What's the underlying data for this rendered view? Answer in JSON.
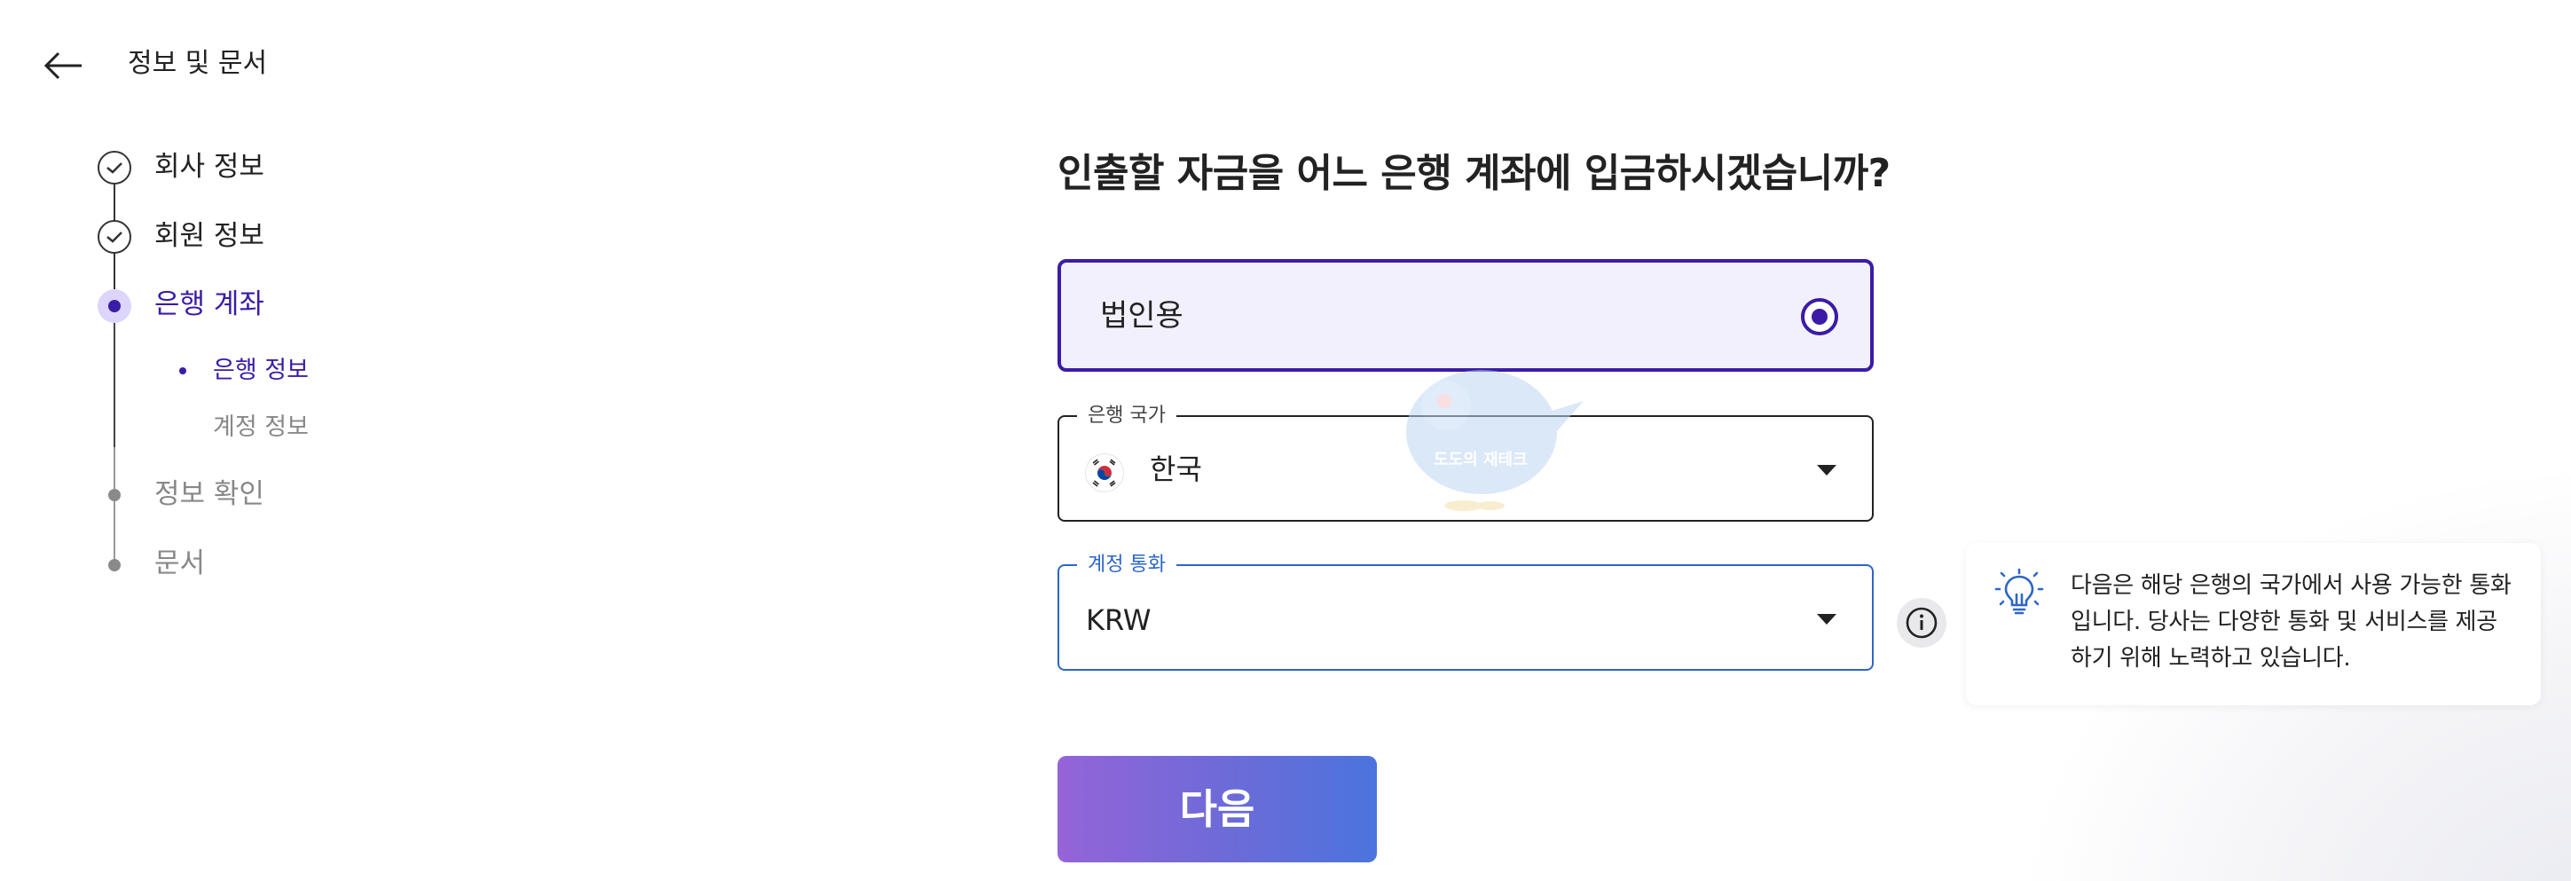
{
  "header": {
    "back_icon": "arrow-left-icon",
    "title": "정보 및 문서"
  },
  "stepper": {
    "steps": [
      {
        "label": "회사 정보",
        "status": "completed"
      },
      {
        "label": "회원 정보",
        "status": "completed"
      },
      {
        "label": "은행 계좌",
        "status": "active"
      },
      {
        "label": "정보 확인",
        "status": "pending"
      },
      {
        "label": "문서",
        "status": "pending"
      }
    ],
    "substeps": [
      {
        "label": "은행 정보",
        "status": "active"
      },
      {
        "label": "계정 정보",
        "status": "pending"
      }
    ]
  },
  "main": {
    "question": "인출할 자금을 어느 은행 계좌에 입금하시겠습니까?",
    "account_type": {
      "label": "법인용",
      "selected": true
    },
    "bank_country": {
      "legend": "은행 국가",
      "value": "한국",
      "flag": "south-korea-flag"
    },
    "currency": {
      "legend": "계정 통화",
      "value": "KRW"
    },
    "next_button": "다음"
  },
  "tooltip": {
    "icon": "lightbulb-icon",
    "text": "다음은 해당 은행의 국가에서 사용 가능한 통화입니다. 당사는 다양한 통화 및 서비스를 제공하기 위해 노력하고 있습니다."
  },
  "watermark": {
    "text": "도도의 재테크"
  },
  "colors": {
    "primary": "#3b1ca6",
    "selected_bg": "#f3f0fe",
    "focus_blue": "#2d66c6",
    "button_gradient_start": "#9564d8",
    "button_gradient_end": "#4b74dc",
    "completed_text": "#222222",
    "pending_text": "#888888"
  }
}
